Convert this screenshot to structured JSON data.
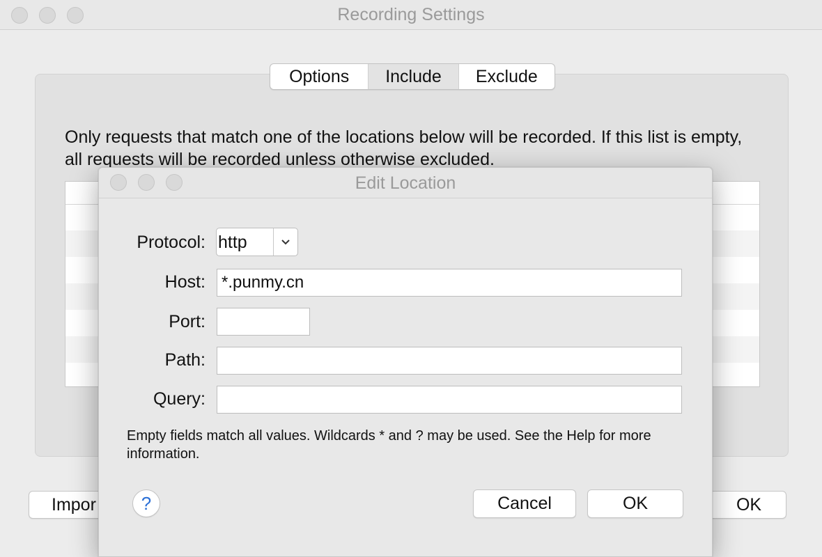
{
  "main_window": {
    "title": "Recording Settings",
    "tabs": [
      {
        "label": "Options",
        "active": false
      },
      {
        "label": "Include",
        "active": true
      },
      {
        "label": "Exclude",
        "active": false
      }
    ],
    "description": "Only requests that match one of the locations below will be recorded. If this list is empty, all requests will be recorded unless otherwise excluded.",
    "import_button_label": "Impor",
    "ok_button_label": "OK"
  },
  "dialog": {
    "title": "Edit Location",
    "fields": {
      "protocol_label": "Protocol:",
      "protocol_value": "http",
      "host_label": "Host:",
      "host_value": "*.punmy.cn",
      "port_label": "Port:",
      "port_value": "",
      "path_label": "Path:",
      "path_value": "",
      "query_label": "Query:",
      "query_value": ""
    },
    "note": "Empty fields match all values. Wildcards * and ? may be used. See the Help for more information.",
    "help_glyph": "?",
    "cancel_label": "Cancel",
    "ok_label": "OK"
  },
  "colors": {
    "window_bg": "#ececec",
    "help_accent": "#2a6fd6"
  }
}
